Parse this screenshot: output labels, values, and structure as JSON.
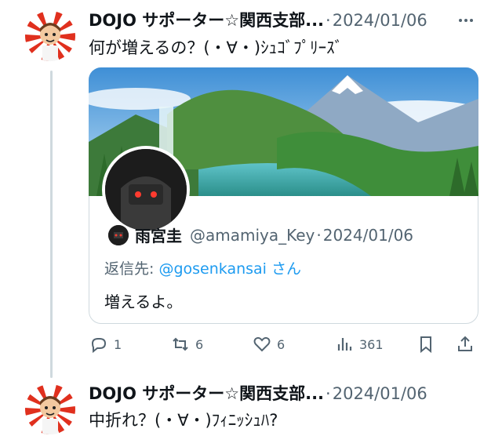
{
  "tweets": [
    {
      "author": "DOJO サポーター☆関西支部...",
      "date": "2024/01/06",
      "text": "何が増えるの？(・∀・)ｼｭｺﾞﾌﾟﾘｰｽﾞ"
    },
    {
      "author": "DOJO サポーター☆関西支部...",
      "date": "2024/01/06",
      "text": "中折れ？(・∀・)ﾌｨﾆｯｼｭﾊ?"
    }
  ],
  "separator": "·",
  "quote": {
    "name": "雨宮圭",
    "handle": "@amamiya_Key",
    "date": "2024/01/06",
    "reply_prefix": "返信先: ",
    "reply_mention": "@gosenkansai",
    "reply_suffix": " さん",
    "text": "増えるよ。"
  },
  "actions": {
    "replies": "1",
    "retweets": "6",
    "likes": "6",
    "views": "361"
  },
  "colors": {
    "accent": "#1d9bf0",
    "secondary_text": "#536471",
    "border": "#cfd9de"
  },
  "icons": [
    "more-icon",
    "reply-icon",
    "retweet-icon",
    "like-icon",
    "views-icon",
    "bookmark-icon",
    "share-icon"
  ]
}
